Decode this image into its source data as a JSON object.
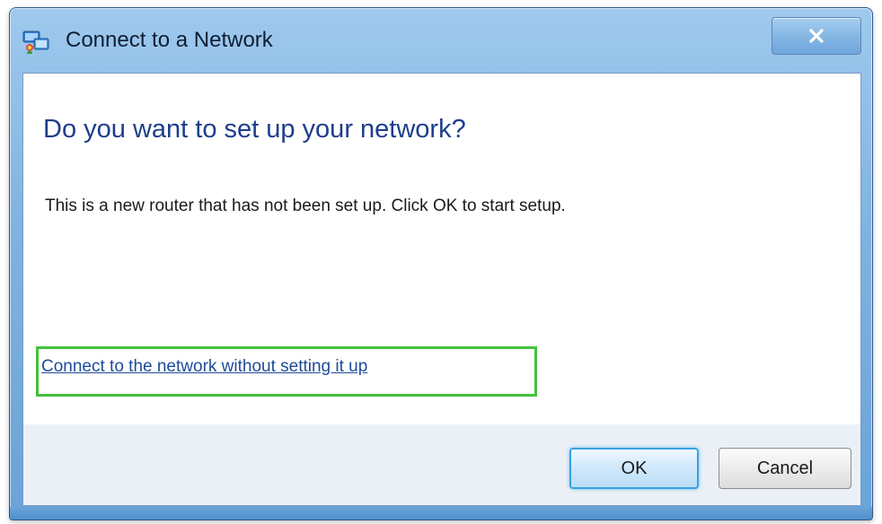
{
  "window": {
    "title": "Connect to a Network",
    "title_icon": "network-icon",
    "close_icon": "close-icon",
    "close_symbol": "✕"
  },
  "main": {
    "heading": "Do you want to set up your network?",
    "description": "This is a new router that has not been set up. Click OK to start setup.",
    "link": "Connect to the network without setting it up"
  },
  "buttons": {
    "ok": "OK",
    "cancel": "Cancel"
  },
  "colors": {
    "heading": "#1e3d8c",
    "link": "#1f4b9b",
    "highlight_box": "#43c23a",
    "titlebar": "#7fb2e0"
  }
}
